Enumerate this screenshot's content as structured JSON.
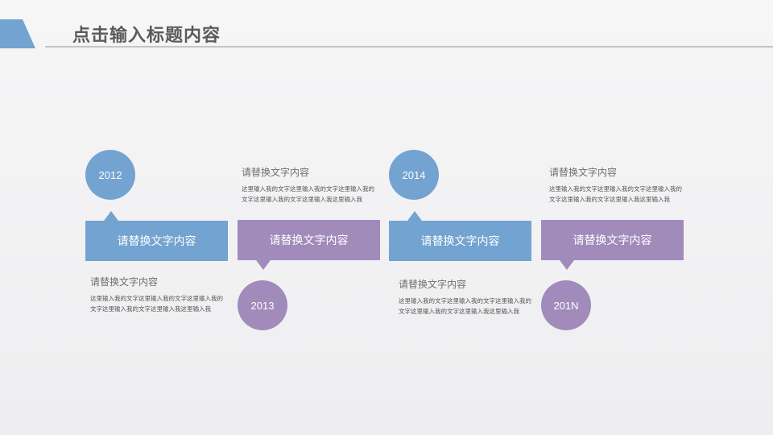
{
  "title": "点击输入标题内容",
  "colors": {
    "blue": "#73a3d0",
    "purple": "#a08bbb",
    "title_rule": "#c4c4cc",
    "title_text": "#5b5b5b"
  },
  "timeline": [
    {
      "year": "2012",
      "box_label": "请替换文字内容",
      "note_heading": "请替换文字内容",
      "note_body": "这里输入我的文字这里输入我的文字这里输入我的文字这里输入我的文字这里输入我这里输入我",
      "color": "blue"
    },
    {
      "year": "2013",
      "box_label": "请替换文字内容",
      "note_heading": "请替换文字内容",
      "note_body": "这里输入我的文字这里输入我的文字这里输入我的文字这里输入我的文字这里输入我这里输入我",
      "color": "purple"
    },
    {
      "year": "2014",
      "box_label": "请替换文字内容",
      "note_heading": "请替换文字内容",
      "note_body": "这里输入我的文字这里输入我的文字这里输入我的文字这里输入我的文字这里输入我这里输入我",
      "color": "blue"
    },
    {
      "year": "201N",
      "box_label": "请替换文字内容",
      "note_heading": "请替换文字内容",
      "note_body": "这里输入我的文字这里输入我的文字这里输入我的文字这里输入我的文字这里输入我这里输入我",
      "color": "purple"
    }
  ]
}
